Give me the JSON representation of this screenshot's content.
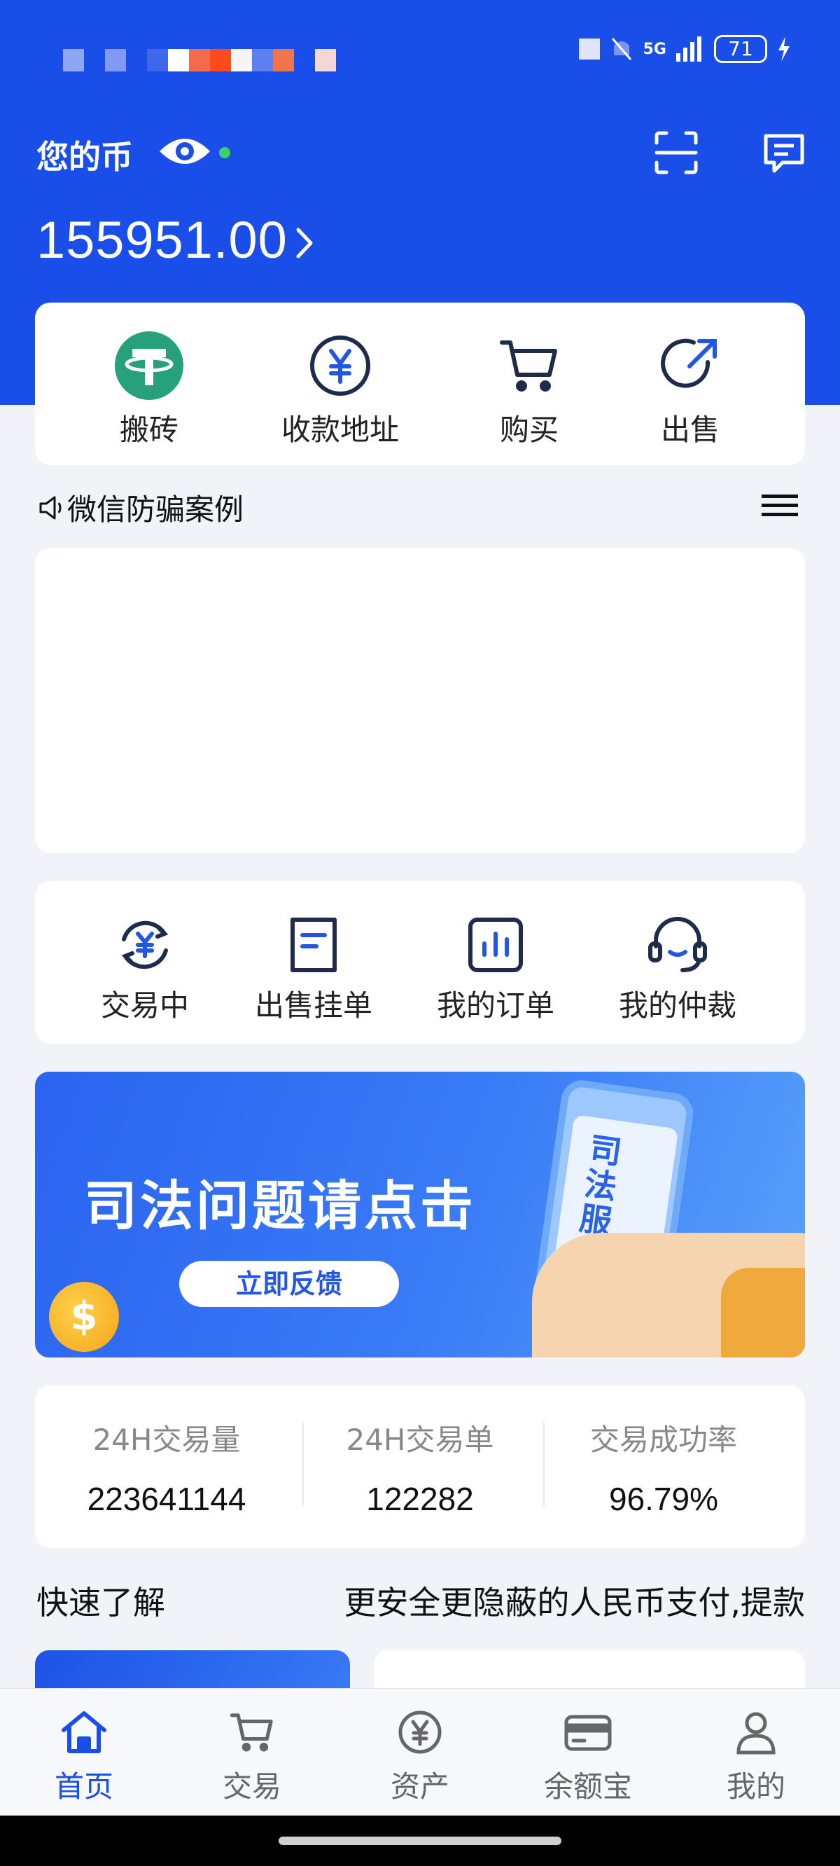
{
  "status_bar": {
    "signal": "5G",
    "battery": "71"
  },
  "header": {
    "title": "您的币",
    "balance": "155951.00"
  },
  "quick_actions": [
    {
      "label": "搬砖",
      "icon": "tether-icon"
    },
    {
      "label": "收款地址",
      "icon": "yuan-circle-icon"
    },
    {
      "label": "购买",
      "icon": "cart-icon"
    },
    {
      "label": "出售",
      "icon": "sell-arrow-icon"
    }
  ],
  "notice": {
    "text": "微信防骗案例"
  },
  "order_actions": [
    {
      "label": "交易中",
      "icon": "exchange-yuan-icon"
    },
    {
      "label": "出售挂单",
      "icon": "document-icon"
    },
    {
      "label": "我的订单",
      "icon": "bar-chart-icon"
    },
    {
      "label": "我的仲裁",
      "icon": "headset-icon"
    }
  ],
  "banner": {
    "title": "司法问题请点击",
    "button": "立即反馈",
    "phone_text": "司法服务"
  },
  "stats": [
    {
      "label": "24H交易量",
      "value": "223641144"
    },
    {
      "label": "24H交易单",
      "value": "122282"
    },
    {
      "label": "交易成功率",
      "value": "96.79%"
    }
  ],
  "quick_learn": {
    "title": "快速了解",
    "subtitle": "更安全更隐蔽的人民币支付,提款"
  },
  "tabs": [
    {
      "label": "首页",
      "icon": "home-icon",
      "active": true
    },
    {
      "label": "交易",
      "icon": "cart-icon",
      "active": false
    },
    {
      "label": "资产",
      "icon": "yuan-coin-icon",
      "active": false
    },
    {
      "label": "余额宝",
      "icon": "card-icon",
      "active": false
    },
    {
      "label": "我的",
      "icon": "user-icon",
      "active": false
    }
  ],
  "colors": {
    "brand_blue": "#1a4ee8",
    "tether_green": "#26a17b",
    "online_dot": "#3cd26a"
  }
}
